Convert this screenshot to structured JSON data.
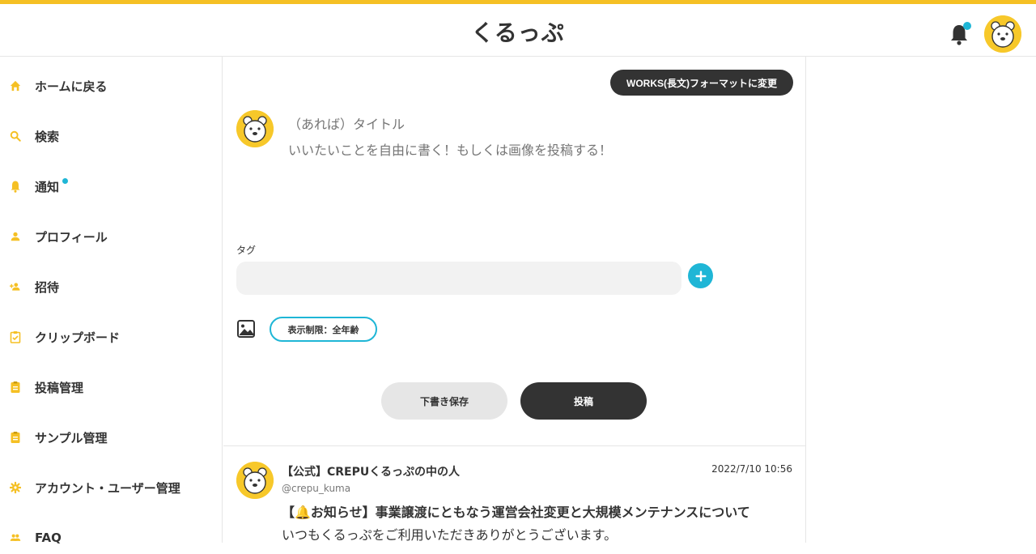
{
  "header": {
    "app_title": "くるっぷ",
    "notification_icon": "bell-icon",
    "avatar_icon": "bear-avatar"
  },
  "sidebar": {
    "items": [
      {
        "label": "ホームに戻る",
        "icon": "home-icon"
      },
      {
        "label": "検索",
        "icon": "search-icon"
      },
      {
        "label": "通知",
        "icon": "bell-icon"
      },
      {
        "label": "プロフィール",
        "icon": "person-icon"
      },
      {
        "label": "招待",
        "icon": "person-add-icon"
      },
      {
        "label": "クリップボード",
        "icon": "clipboard-icon"
      },
      {
        "label": "投稿管理",
        "icon": "document-icon"
      },
      {
        "label": "サンプル管理",
        "icon": "document-icon"
      },
      {
        "label": "アカウント・ユーザー管理",
        "icon": "gear-icon"
      },
      {
        "label": "FAQ",
        "icon": "people-icon"
      }
    ]
  },
  "composer": {
    "format_button": "WORKS(長文)フォーマットに変更",
    "title_placeholder": "（あれば）タイトル",
    "body_placeholder": "いいたいことを自由に書く！もしくは画像を投稿する！",
    "tag_label": "タグ",
    "rating_button": "表示制限：全年齢",
    "draft_button": "下書き保存",
    "post_button": "投稿"
  },
  "feed": {
    "post": {
      "author": "【公式】CREPUくるっぷの中の人",
      "handle": "@crepu_kuma",
      "date": "2022/7/10 10:56",
      "headline": "【🔔お知らせ】事業譲渡にともなう運営会社変更と大規模メンテナンスについて",
      "body": "いつもくるっぷをご利用いただきありがとうございます。"
    }
  },
  "colors": {
    "accent_yellow": "#f5c024",
    "accent_cyan": "#1fb6d6",
    "dark": "#333333"
  }
}
